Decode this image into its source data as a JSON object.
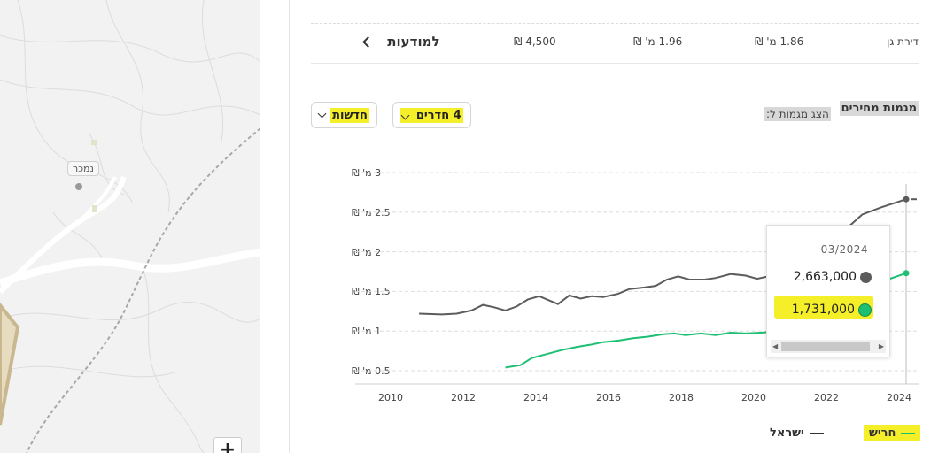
{
  "map": {
    "place_label": "נמכר",
    "zoom_in_label": "+"
  },
  "summary": {
    "cells": [
      "דירת גן",
      "1.86 מ' ₪",
      "1.96 מ' ₪",
      "4,500 ₪"
    ],
    "info_link": "למודעות"
  },
  "trends": {
    "title": "מגמות מחירים",
    "show_label": "הצג מגמות ל:",
    "rooms_dropdown": "4 חדרים",
    "type_dropdown": "חדשות"
  },
  "tooltip": {
    "date": "03/2024",
    "israel_value": "2,663,000",
    "harish_value": "1,731,000"
  },
  "legend": {
    "harish": "חריש",
    "israel": "ישראל"
  },
  "colors": {
    "israel": "#5c5c5c",
    "harish": "#1dbf73",
    "highlight": "#f5ef2a"
  },
  "chart_data": {
    "type": "line",
    "y_ticks": [
      "3 מ' ₪",
      "2.5 מ' ₪",
      "2 מ' ₪",
      "1.5 מ' ₪",
      "1 מ' ₪",
      "0.5 מ' ₪"
    ],
    "x_ticks": [
      "2010",
      "2012",
      "2014",
      "2016",
      "2018",
      "2020",
      "2022",
      "2024"
    ],
    "ylim": [
      0.5,
      3
    ],
    "xlim": [
      2009.5,
      2024.5
    ],
    "series": [
      {
        "name": "ישראל",
        "color": "#5c5c5c",
        "points": [
          [
            2011.2,
            1.22
          ],
          [
            2011.8,
            1.21
          ],
          [
            2012.2,
            1.22
          ],
          [
            2012.6,
            1.26
          ],
          [
            2012.9,
            1.33
          ],
          [
            2013.2,
            1.3
          ],
          [
            2013.5,
            1.26
          ],
          [
            2013.8,
            1.31
          ],
          [
            2014.1,
            1.4
          ],
          [
            2014.4,
            1.44
          ],
          [
            2014.7,
            1.38
          ],
          [
            2014.9,
            1.34
          ],
          [
            2015.2,
            1.45
          ],
          [
            2015.5,
            1.41
          ],
          [
            2015.8,
            1.44
          ],
          [
            2016.1,
            1.43
          ],
          [
            2016.5,
            1.47
          ],
          [
            2016.8,
            1.53
          ],
          [
            2017.2,
            1.55
          ],
          [
            2017.5,
            1.57
          ],
          [
            2017.8,
            1.65
          ],
          [
            2018.1,
            1.69
          ],
          [
            2018.4,
            1.65
          ],
          [
            2018.8,
            1.65
          ],
          [
            2019.1,
            1.67
          ],
          [
            2019.5,
            1.72
          ],
          [
            2019.9,
            1.7
          ],
          [
            2020.2,
            1.66
          ],
          [
            2020.6,
            1.7
          ],
          [
            2021.0,
            1.73
          ],
          [
            2021.4,
            1.8
          ],
          [
            2021.8,
            1.92
          ],
          [
            2022.2,
            2.1
          ],
          [
            2022.6,
            2.3
          ],
          [
            2023.0,
            2.47
          ],
          [
            2023.5,
            2.56
          ],
          [
            2024.17,
            2.663
          ]
        ]
      },
      {
        "name": "חריש",
        "color": "#1dbf73",
        "points": [
          [
            2013.5,
            0.54
          ],
          [
            2013.9,
            0.57
          ],
          [
            2014.2,
            0.66
          ],
          [
            2014.6,
            0.71
          ],
          [
            2015.0,
            0.76
          ],
          [
            2015.4,
            0.8
          ],
          [
            2015.8,
            0.83
          ],
          [
            2016.1,
            0.86
          ],
          [
            2016.5,
            0.88
          ],
          [
            2016.9,
            0.91
          ],
          [
            2017.3,
            0.93
          ],
          [
            2017.7,
            0.96
          ],
          [
            2018.0,
            0.97
          ],
          [
            2018.3,
            0.95
          ],
          [
            2018.7,
            0.97
          ],
          [
            2019.1,
            0.95
          ],
          [
            2019.5,
            0.98
          ],
          [
            2019.9,
            0.97
          ],
          [
            2020.3,
            0.98
          ],
          [
            2020.6,
            0.99
          ],
          [
            2021.0,
            1.02
          ],
          [
            2021.5,
            1.07
          ],
          [
            2022.0,
            1.18
          ],
          [
            2022.5,
            1.35
          ],
          [
            2023.0,
            1.5
          ],
          [
            2023.5,
            1.62
          ],
          [
            2024.17,
            1.731
          ]
        ]
      }
    ],
    "cursor_x": 2024.17
  }
}
